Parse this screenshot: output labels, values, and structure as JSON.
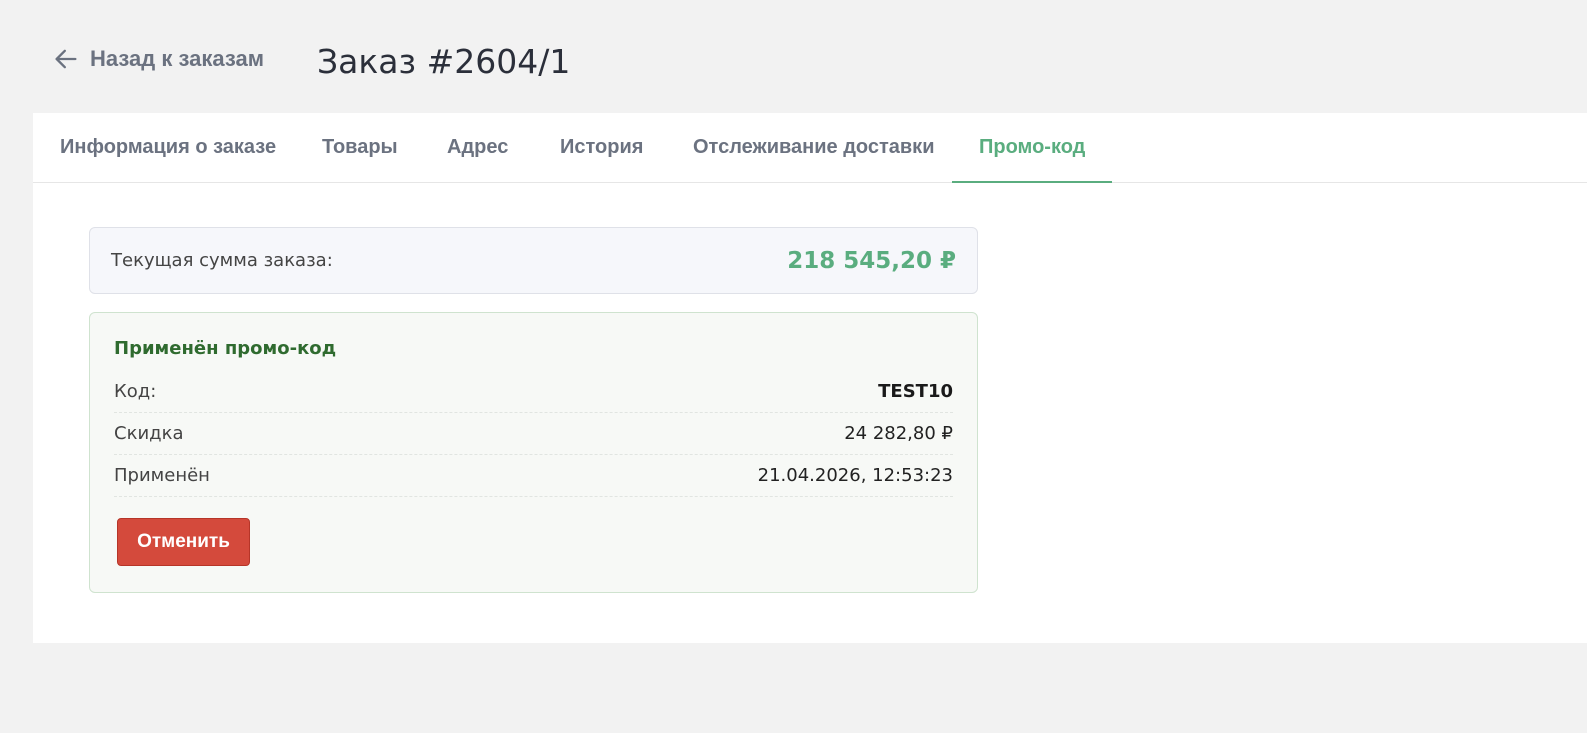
{
  "header": {
    "back_label": "Назад к заказам",
    "title": "Заказ #2604/1"
  },
  "tabs": [
    {
      "label": "Информация о заказе",
      "active": false
    },
    {
      "label": "Товары",
      "active": false
    },
    {
      "label": "Адрес",
      "active": false
    },
    {
      "label": "История",
      "active": false
    },
    {
      "label": "Отслеживание доставки",
      "active": false
    },
    {
      "label": "Промо-код",
      "active": true
    }
  ],
  "summary": {
    "label": "Текущая сумма заказа:",
    "value": "218 545,20 ₽"
  },
  "promo": {
    "title": "Применён промо-код",
    "rows": [
      {
        "key": "Код:",
        "value": "TEST10"
      },
      {
        "key": "Скидка",
        "value": "24 282,80 ₽"
      },
      {
        "key": "Применён",
        "value": "21.04.2026, 12:53:23"
      }
    ],
    "cancel_label": "Отменить"
  },
  "colors": {
    "accent": "#5aad7f",
    "danger": "#d44a3c",
    "promo_title": "#2f6b2f"
  },
  "icons": {
    "back": "arrow-left-icon"
  }
}
